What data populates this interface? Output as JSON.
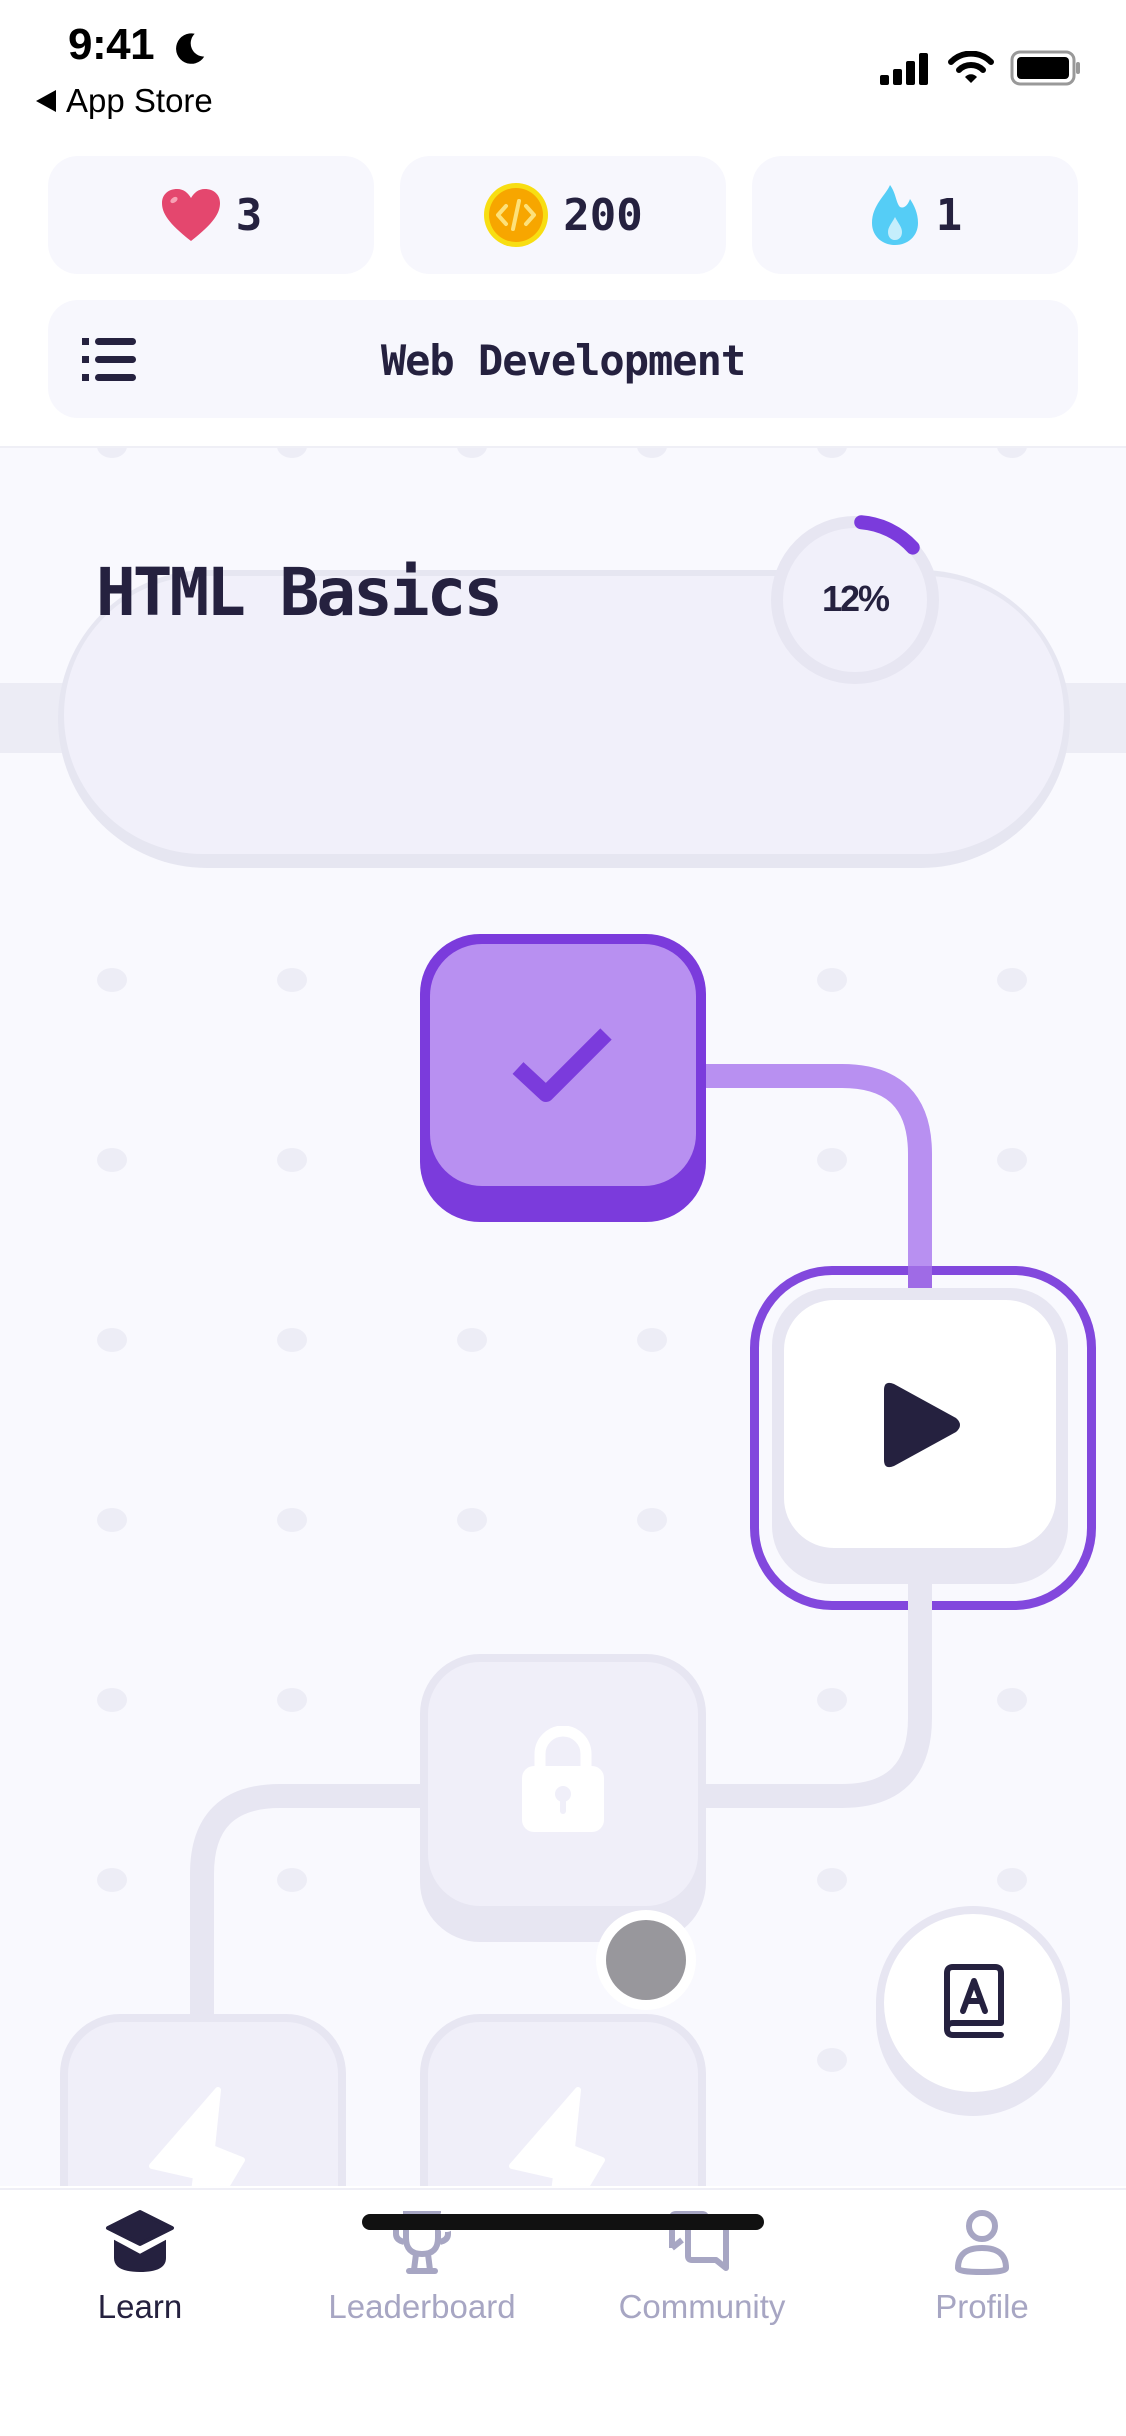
{
  "status_bar": {
    "time": "9:41",
    "back_label": "App Store",
    "icons": [
      "moon-icon",
      "signal-icon",
      "wifi-icon",
      "battery-icon"
    ]
  },
  "stats": {
    "lives": {
      "icon": "heart-icon",
      "value": "3",
      "color": "#e4476e"
    },
    "coins": {
      "icon": "code-coin-icon",
      "value": "200",
      "color": "#f7a600"
    },
    "streak": {
      "icon": "flame-icon",
      "value": "1",
      "color": "#55cdf6"
    }
  },
  "course": {
    "menu_icon": "list-icon",
    "title": "Web Development"
  },
  "unit": {
    "title": "HTML Basics",
    "progress_label": "12%",
    "progress_fraction": 0.12
  },
  "path_nodes": [
    {
      "state": "completed",
      "icon": "check-icon"
    },
    {
      "state": "current",
      "icon": "play-icon"
    },
    {
      "state": "locked",
      "icon": "lock-icon"
    },
    {
      "state": "locked",
      "icon": "bolt-icon"
    },
    {
      "state": "locked",
      "icon": "bolt-icon"
    }
  ],
  "floating": {
    "glossary_icon": "dictionary-icon",
    "avatar_icon": "user-avatar-dot"
  },
  "tabs": [
    {
      "label": "Learn",
      "icon": "graduation-cap-icon",
      "active": true
    },
    {
      "label": "Leaderboard",
      "icon": "trophy-icon",
      "active": false,
      "badge": true
    },
    {
      "label": "Community",
      "icon": "chat-bubbles-icon",
      "active": false
    },
    {
      "label": "Profile",
      "icon": "person-icon",
      "active": false
    }
  ],
  "colors": {
    "accent": "#7b3bdc",
    "accent_light": "#b890f1",
    "text_dark": "#25213f",
    "tab_inactive": "#a7a6c3",
    "badge": "#e63b5e"
  }
}
